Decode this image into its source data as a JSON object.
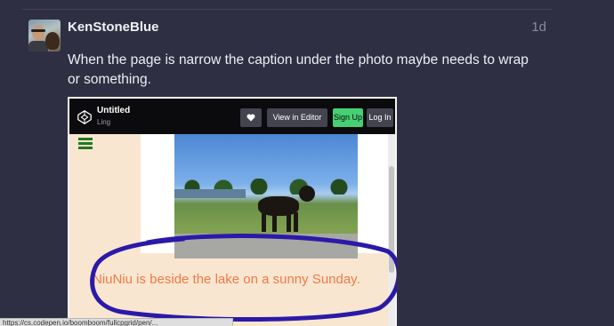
{
  "post": {
    "username": "KenStoneBlue",
    "time": "1d",
    "text": "When the page is narrow the caption under the photo maybe needs to wrap or something."
  },
  "embed": {
    "title": "Untitled",
    "author": "Ling",
    "heart_icon": "heart-icon",
    "view_in_editor": "View in Editor",
    "sign_up": "Sign Up",
    "log_in": "Log In",
    "caption": "NiuNiu is beside the lake on a sunny Sunday.",
    "accent": "#47cf73",
    "caption_color": "#ee7a4a",
    "annotation_color": "#2b1aa8"
  },
  "status_bar": {
    "url": "https://cs.codepen.io/boomboom/fullcpgrid/pen/..."
  }
}
